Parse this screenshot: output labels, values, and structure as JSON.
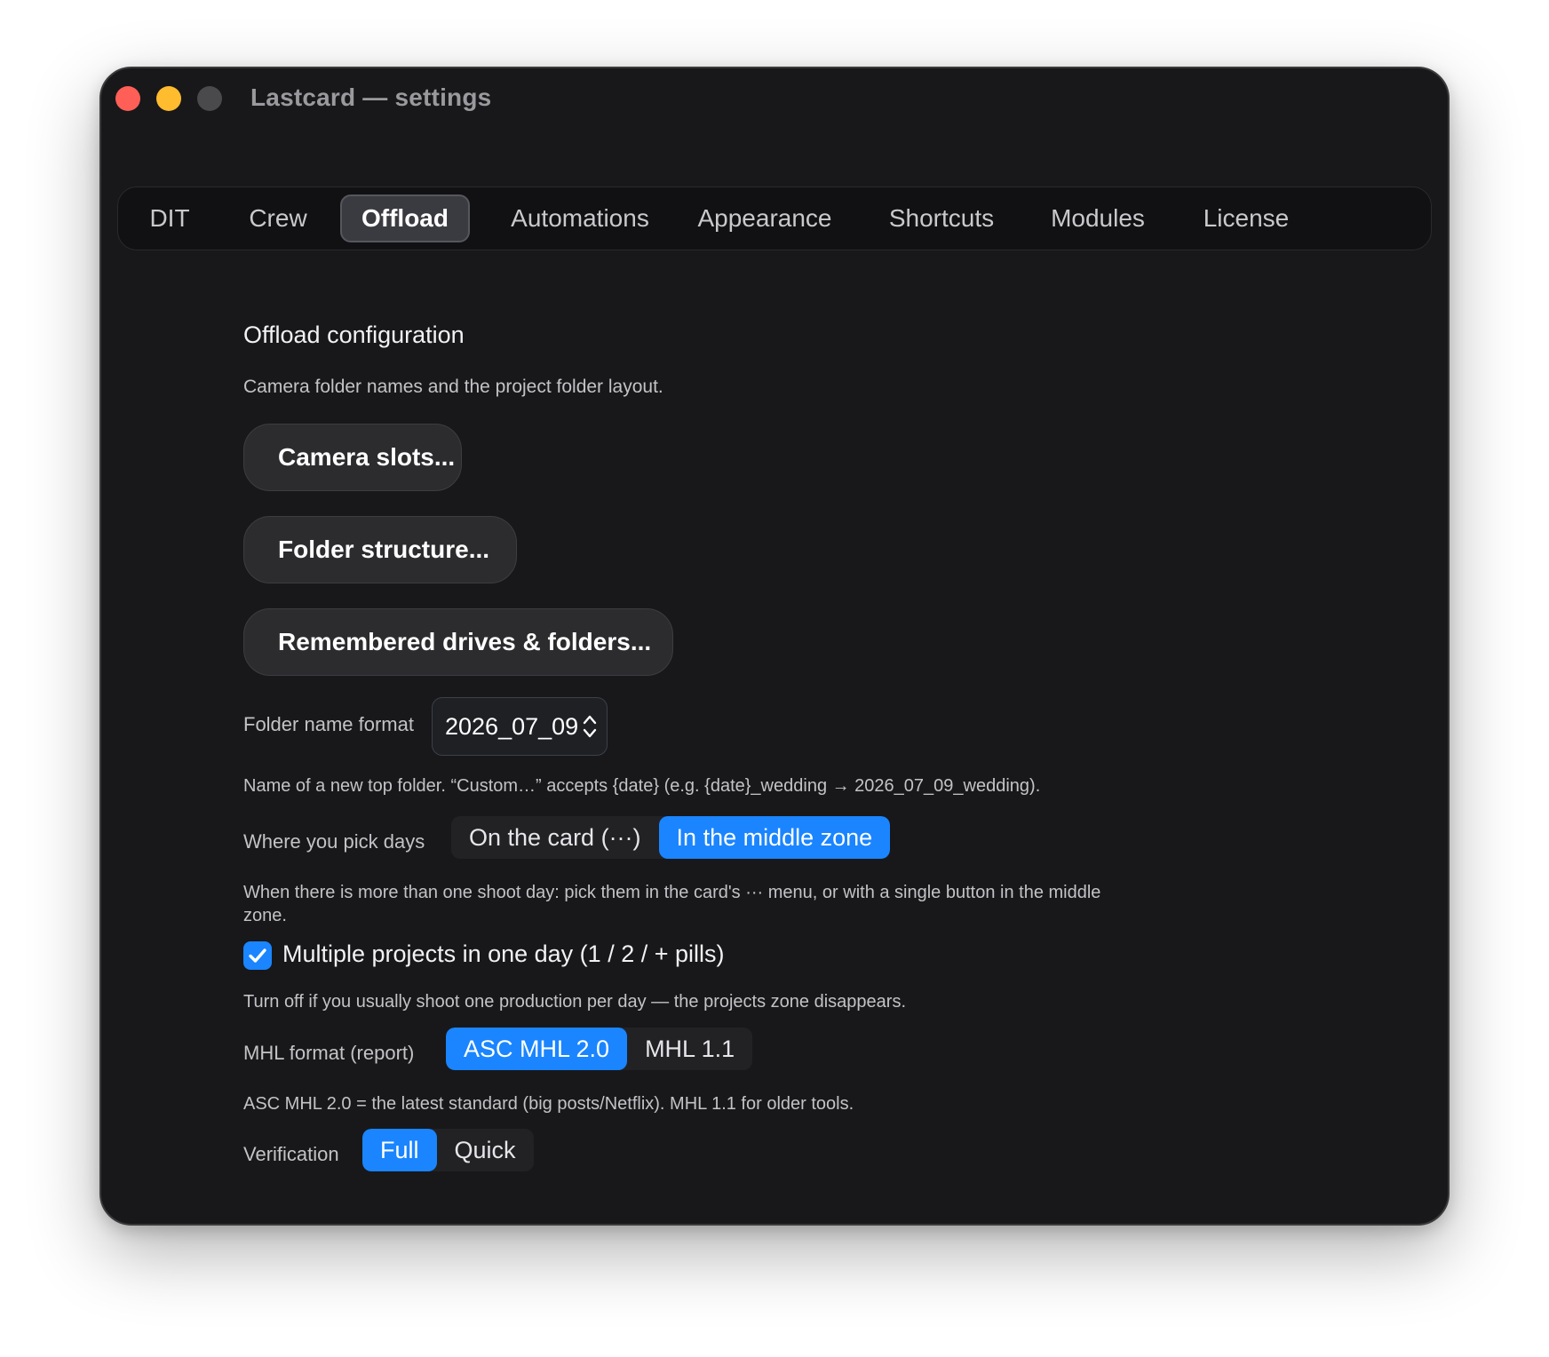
{
  "window": {
    "title": "Lastcard — settings"
  },
  "tabs": [
    {
      "label": "DIT"
    },
    {
      "label": "Crew"
    },
    {
      "label": "Offload"
    },
    {
      "label": "Automations"
    },
    {
      "label": "Appearance"
    },
    {
      "label": "Shortcuts"
    },
    {
      "label": "Modules"
    },
    {
      "label": "License"
    }
  ],
  "active_tab": "Offload",
  "offload": {
    "section_title": "Offload configuration",
    "section_desc": "Camera folder names and the project folder layout.",
    "buttons": {
      "camera_slots": "Camera slots...",
      "folder_structure": "Folder structure...",
      "remembered": "Remembered drives & folders..."
    },
    "folder_name_format": {
      "label": "Folder name format",
      "value": "2026_07_09",
      "help": "Name of a new top folder. “Custom…” accepts {date} (e.g. {date}_wedding → 2026_07_09_wedding)."
    },
    "pick_days": {
      "label": "Where you pick days",
      "options": [
        "On the card (···)",
        "In the middle zone"
      ],
      "selected": "In the middle zone",
      "help_line1": "When there is more than one shoot day: pick them in the card's ··· menu, or with a single button in the middle",
      "help_line2": "zone."
    },
    "multiple_projects": {
      "label": "Multiple projects in one day (1 / 2 / + pills)",
      "checked": true,
      "help": "Turn off if you usually shoot one production per day — the projects zone disappears."
    },
    "mhl_format": {
      "label": "MHL format (report)",
      "options": [
        "ASC MHL 2.0",
        "MHL 1.1"
      ],
      "selected": "ASC MHL 2.0",
      "help": "ASC MHL 2.0 = the latest standard (big posts/Netflix). MHL 1.1 for older tools."
    },
    "verification": {
      "label": "Verification",
      "options": [
        "Full",
        "Quick"
      ],
      "selected": "Full"
    }
  },
  "colors": {
    "accent": "#1a85ff",
    "window_bg": "#18181a",
    "close": "#ff5f57",
    "minimize": "#febc2e"
  }
}
